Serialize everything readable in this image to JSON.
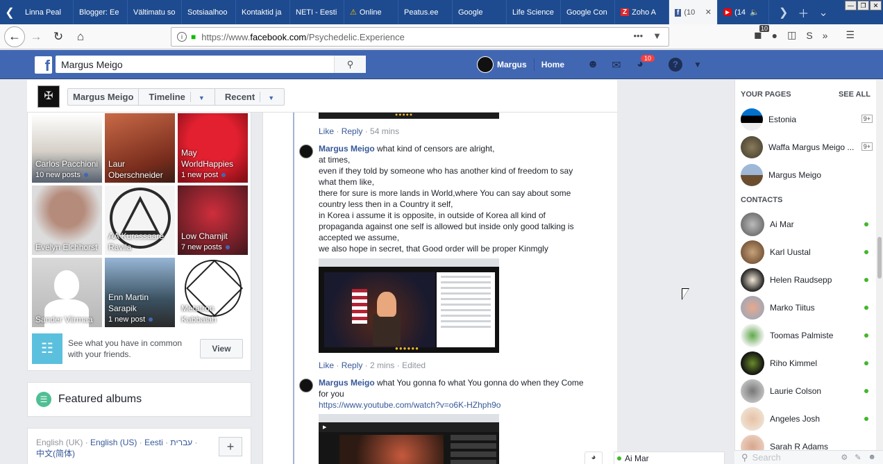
{
  "browser": {
    "tabs": [
      {
        "label": "Linna Peal"
      },
      {
        "label": "Blogger: Ee"
      },
      {
        "label": "Vältimatu so"
      },
      {
        "label": "Sotsiaalhoo"
      },
      {
        "label": "Kontaktid ja"
      },
      {
        "label": "NETI - Eesti"
      },
      {
        "label": "Online"
      },
      {
        "label": "Peatus.ee"
      },
      {
        "label": "Google"
      },
      {
        "label": "Life Science"
      },
      {
        "label": "Google Con"
      },
      {
        "label": "Zoho A"
      },
      {
        "label": "(10"
      },
      {
        "label": "(14"
      }
    ],
    "url": {
      "prefix": "https://www.",
      "domain": "facebook.com",
      "path": "/Psychedelic.Experience"
    },
    "extension_badge": "10",
    "colors": {
      "tabbar": "#1e4b8f",
      "fb_blue": "#4267b2"
    }
  },
  "fb": {
    "search_value": "Margus Meigo",
    "user_name": "Margus",
    "home_label": "Home",
    "notifications_count": "10"
  },
  "page_header": {
    "crumbs": [
      "Margus Meigo",
      "Timeline",
      "Recent"
    ]
  },
  "friends": [
    {
      "name": "Carlos Pacchioni",
      "posts": "10 new posts"
    },
    {
      "name": "Laur Oberschneider",
      "posts": ""
    },
    {
      "name": "May WorldHappies",
      "posts": "1 new post"
    },
    {
      "name": "Evelyn Elchhorst",
      "posts": ""
    },
    {
      "name": "AA Kuressaare Ravila",
      "posts": ""
    },
    {
      "name": "Low Charnjit",
      "posts": "7 new posts"
    },
    {
      "name": "Sander Viirmaa",
      "posts": ""
    },
    {
      "name": "Enn Martin Sarapik",
      "posts": "1 new post"
    },
    {
      "name": "Metatron Kabbalah",
      "posts": ""
    }
  ],
  "common": {
    "text": "See what you have in common with your friends.",
    "button": "View"
  },
  "albums": {
    "title": "Featured albums"
  },
  "languages": {
    "items": [
      "English (UK)",
      "English (US)",
      "Eesti",
      "עברית",
      "中文(简体)"
    ],
    "sep": " · "
  },
  "feed": {
    "first_actions": {
      "like": "Like",
      "reply": "Reply",
      "time": "54 mins"
    },
    "comment1": {
      "author": "Margus Meigo",
      "text": " what kind of censors are alright,\nat times,\neven if they told by someone who has another kind of freedom to say what them like,\nthere for sure is more lands in World,where You can say about some country less then in a Country it self,\nin Korea i assume it is opposite, in outside of Korea all kind of propaganda against one self is allowed but inside only good talking is accepted we assume,\nwe also hope in secret, that Good order will be proper Kinmgly"
    },
    "second_actions": {
      "like": "Like",
      "reply": "Reply",
      "time": "2 mins",
      "edited": "Edited"
    },
    "comment2": {
      "author": "Margus Meigo",
      "text": " what You gonna fo what You gonna do when they Come for you",
      "url": "https://www.youtube.com/watch?v=o6K-HZhph9o"
    }
  },
  "sidebar": {
    "your_pages_label": "YOUR PAGES",
    "see_all_label": "SEE ALL",
    "pages": [
      {
        "name": "Estonia",
        "badge": "9+"
      },
      {
        "name": "Waffa Margus Meigo ...",
        "badge": "9+"
      },
      {
        "name": "Margus Meigo",
        "badge": ""
      }
    ],
    "contacts_label": "CONTACTS",
    "contacts": [
      {
        "name": "Ai Mar"
      },
      {
        "name": "Karl Uustal"
      },
      {
        "name": "Helen Raudsepp"
      },
      {
        "name": "Marko Tiitus"
      },
      {
        "name": "Toomas Palmiste"
      },
      {
        "name": "Riho Kimmel"
      },
      {
        "name": "Laurie Colson"
      },
      {
        "name": "Angeles Josh"
      },
      {
        "name": "Sarah R Adams"
      }
    ],
    "search_placeholder": "Search"
  },
  "chat": {
    "name": "Ai Mar"
  }
}
